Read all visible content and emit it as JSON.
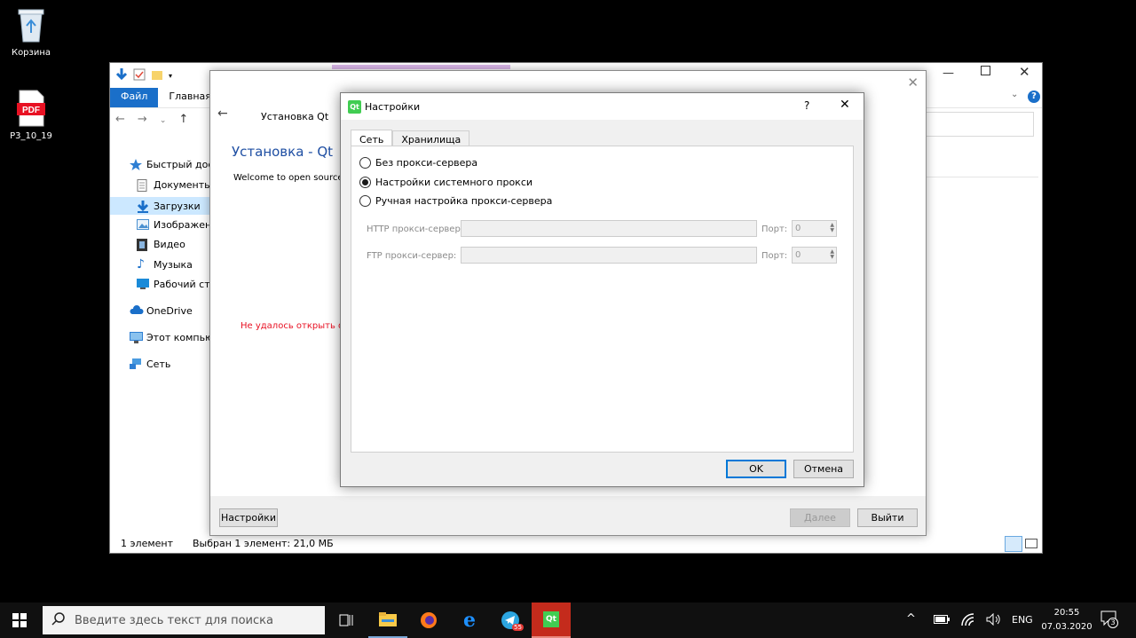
{
  "desktop": {
    "icons": [
      {
        "label": "Корзина"
      },
      {
        "label": "P3_10_19"
      }
    ],
    "pdf_text": "PDF"
  },
  "explorer": {
    "ribbon_tabs": [
      "Файл",
      "Главная"
    ],
    "sidebar": [
      {
        "label": "Быстрый дост"
      },
      {
        "label": "Документы"
      },
      {
        "label": "Загрузки"
      },
      {
        "label": "Изображени"
      },
      {
        "label": "Видео"
      },
      {
        "label": "Музыка"
      },
      {
        "label": "Рабочий сто"
      },
      {
        "label": "OneDrive"
      },
      {
        "label": "Этот компьют"
      },
      {
        "label": "Сеть"
      }
    ],
    "status": {
      "count": "1 элемент",
      "selected": "Выбран 1 элемент: 21,0 МБ"
    }
  },
  "installer": {
    "nav_title": "Установка Qt",
    "heading": "Установка - Qt",
    "welcome": "Welcome to open source Q",
    "error": "Не удалось открыть фа",
    "buttons": {
      "settings": "Настройки",
      "next": "Далее",
      "exit": "Выйти"
    }
  },
  "settings": {
    "qt_logo": "Qt",
    "title": "Настройки",
    "help": "?",
    "tabs": [
      "Сеть",
      "Хранилища"
    ],
    "radios": [
      {
        "label": "Без прокси-сервера",
        "checked": false
      },
      {
        "label": "Настройки системного прокси",
        "checked": true
      },
      {
        "label": "Ручная настройка прокси-сервера",
        "checked": false
      }
    ],
    "http_label": "HTTP прокси-сервер:",
    "ftp_label": "FTP прокси-сервер:",
    "port_label": "Порт:",
    "http_port": "0",
    "ftp_port": "0",
    "ok": "OK",
    "cancel": "Отмена"
  },
  "taskbar": {
    "search_placeholder": "Введите здесь текст для поиска",
    "telegram_badge": "55",
    "qt_label": "Qt",
    "language": "ENG",
    "time": "20:55",
    "date": "07.03.2020",
    "notifications": "3"
  },
  "colors": {
    "accent": "#1a6fc9",
    "qt_green": "#41cd52",
    "error": "#e81123"
  }
}
